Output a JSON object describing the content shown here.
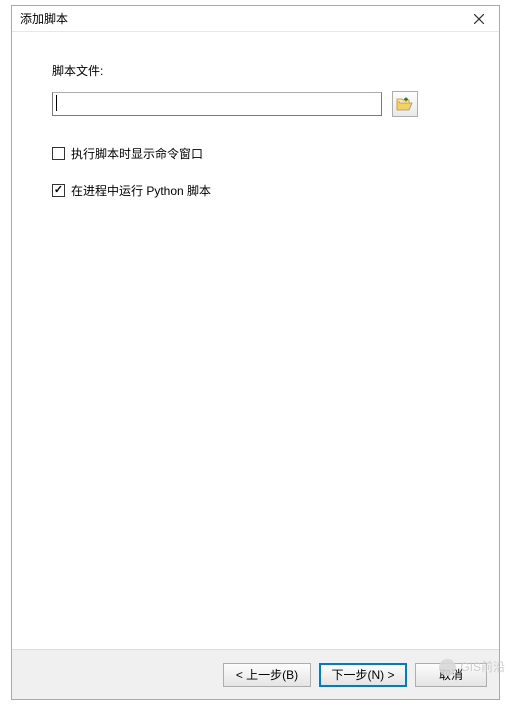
{
  "titlebar": {
    "title": "添加脚本"
  },
  "content": {
    "file_label": "脚本文件:",
    "file_value": "",
    "checkbox_show_cmd": {
      "label": "执行脚本时显示命令窗口",
      "checked": false
    },
    "checkbox_in_process": {
      "label": "在进程中运行 Python 脚本",
      "checked": true
    }
  },
  "footer": {
    "back_label": "< 上一步(B)",
    "next_label": "下一步(N) >",
    "cancel_label": "取消"
  },
  "watermark": "GIS前沿"
}
